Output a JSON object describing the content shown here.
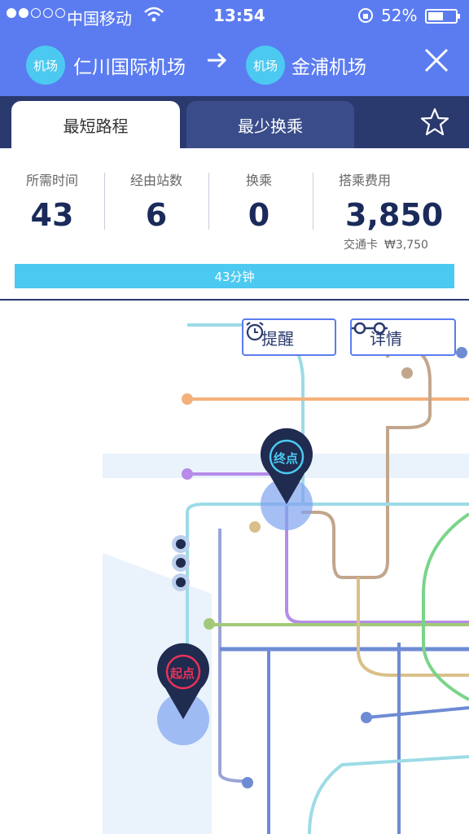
{
  "status": {
    "carrier": "中国移动",
    "time": "13:54",
    "battery": "52%"
  },
  "route": {
    "from_badge": "机场",
    "from_name": "仁川国际机场",
    "to_badge": "机场",
    "to_name": "金浦机场"
  },
  "tabs": {
    "shortest": "最短路程",
    "fewest": "最少换乘"
  },
  "stats": {
    "time_label": "所需时间",
    "time_value": "43",
    "stops_label": "经由站数",
    "stops_value": "6",
    "transfer_label": "换乘",
    "transfer_value": "0",
    "fare_label": "搭乘费用",
    "fare_value": "3,850",
    "card_label": "交通卡",
    "card_fare": "₩3,750"
  },
  "progress": {
    "label": "43分钟",
    "fraction": 1.0
  },
  "map": {
    "alarm_label": "提醒",
    "detail_label": "详情",
    "end_pin": "终点",
    "start_pin": "起点"
  },
  "colors": {
    "header": "#5b7cf0",
    "tabbar": "#2a3a6e",
    "accent": "#4cc9f0",
    "pin_dark": "#1f2b4f",
    "pin_end_ring": "#4cc9f0",
    "pin_start_ring": "#e8325a"
  },
  "icons": {
    "wifi": "wifi-icon",
    "lock": "rotation-lock-icon",
    "close": "close-icon",
    "star": "star-icon",
    "alarm": "alarm-clock-icon",
    "glasses": "glasses-icon"
  }
}
